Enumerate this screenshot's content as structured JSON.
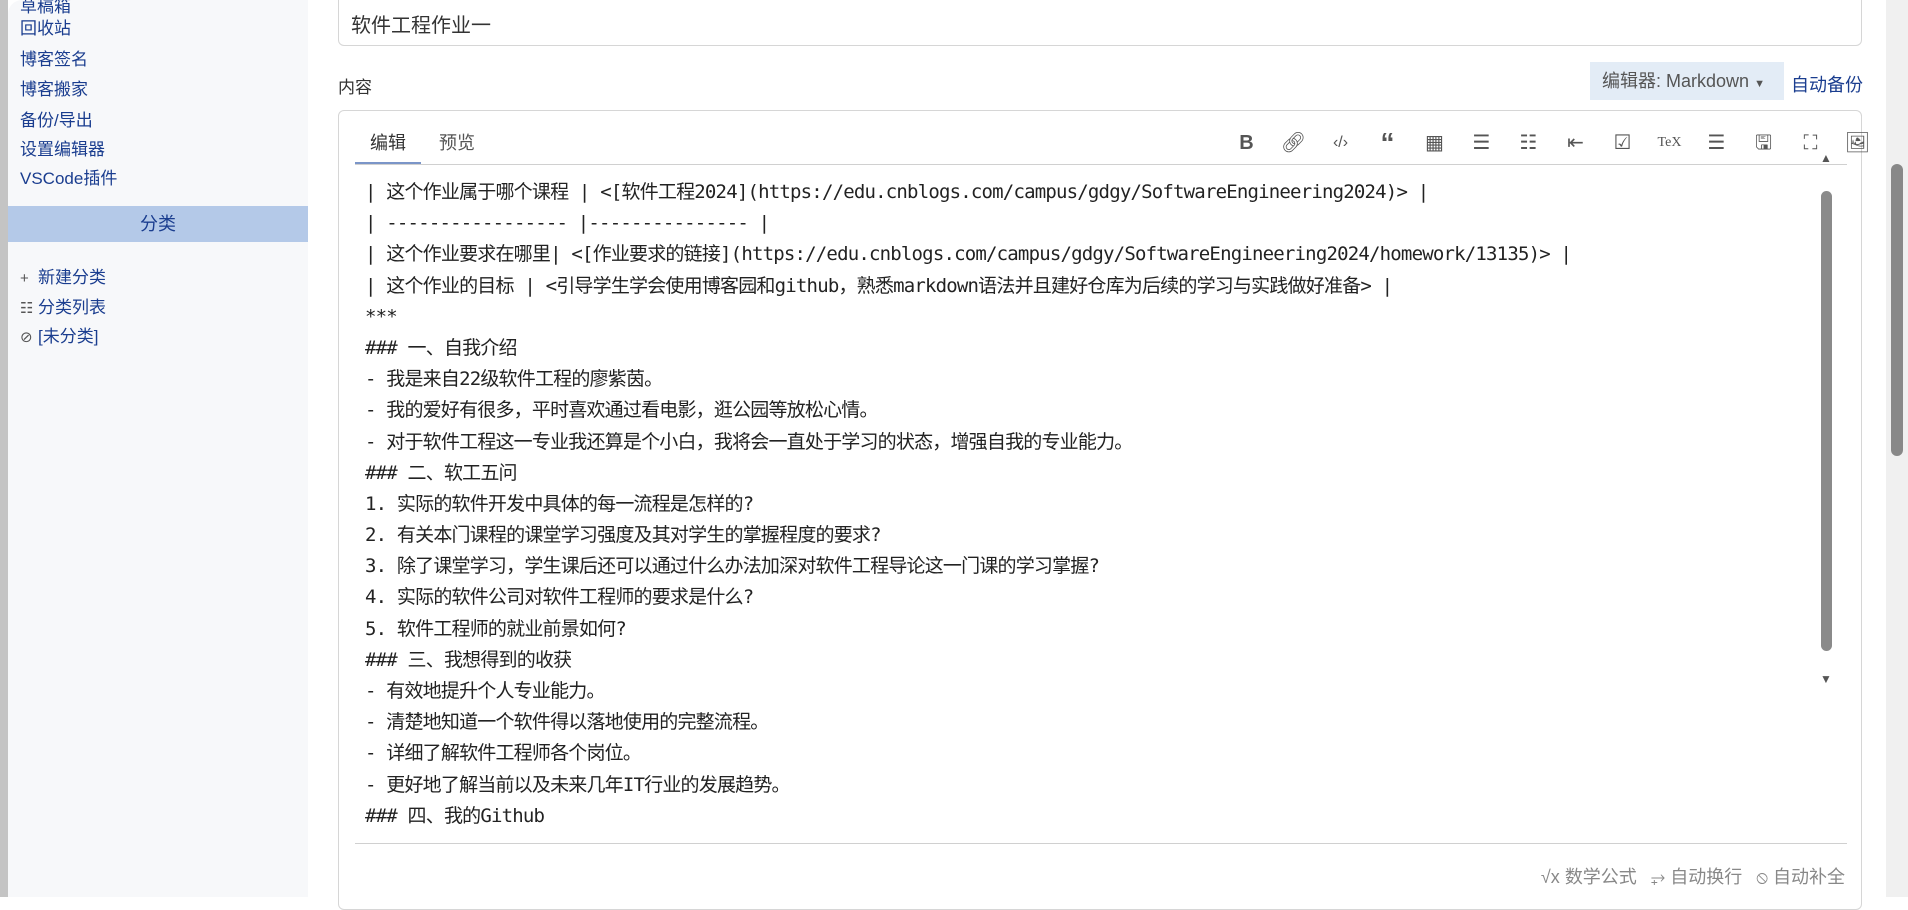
{
  "sidebar": {
    "items": [
      "草稿箱",
      "回收站",
      "博客签名",
      "博客搬家",
      "备份/导出",
      "设置编辑器",
      "VSCode插件"
    ],
    "category_header": "分类",
    "category_items": [
      {
        "icon": "plus-icon",
        "label": "新建分类"
      },
      {
        "icon": "list-icon",
        "label": "分类列表"
      },
      {
        "icon": "folder-off-icon",
        "label": "[未分类]"
      }
    ]
  },
  "title_value": "软件工程作业一",
  "content_label": "内容",
  "editor_select": "编辑器: Markdown",
  "auto_backup": "自动备份",
  "tabs": [
    "编辑",
    "预览"
  ],
  "toolbar": [
    "bold",
    "link",
    "code",
    "quote",
    "table",
    "bullet-list",
    "ordered-list",
    "indent",
    "task",
    "tex",
    "toc",
    "save",
    "fullscreen",
    "image"
  ],
  "lines": [
    "| 这个作业属于哪个课程 | <[软件工程2024](https://edu.cnblogs.com/campus/gdgy/SoftwareEngineering2024)> |",
    "| ----------------- |--------------- |",
    "| 这个作业要求在哪里| <[作业要求的链接](https://edu.cnblogs.com/campus/gdgy/SoftwareEngineering2024/homework/13135)> |",
    "| 这个作业的目标 | <引导学生学会使用博客园和github，熟悉markdown语法并且建好仓库为后续的学习与实践做好准备> |",
    "***",
    "### 一、自我介绍",
    "- 我是来自22级软件工程的廖紫茵。",
    "- 我的爱好有很多，平时喜欢通过看电影，逛公园等放松心情。",
    "- 对于软件工程这一专业我还算是个小白，我将会一直处于学习的状态，增强自我的专业能力。",
    "### 二、软工五问",
    "1. 实际的软件开发中具体的每一流程是怎样的?",
    "2. 有关本门课程的课堂学习强度及其对学生的掌握程度的要求?",
    "3. 除了课堂学习，学生课后还可以通过什么办法加深对软件工程导论这一门课的学习掌握?",
    "4. 实际的软件公司对软件工程师的要求是什么?",
    "5. 软件工程师的就业前景如何?",
    "### 三、我想得到的收获",
    "- 有效地提升个人专业能力。",
    "- 清楚地知道一个软件得以落地使用的完整流程。",
    "- 详细了解软件工程师各个岗位。",
    "- 更好地了解当前以及未来几年IT行业的发展趋势。",
    "### 四、我的Github"
  ],
  "footer": {
    "math": "数学公式",
    "wrap": "自动换行",
    "autocomplete": "自动补全"
  }
}
